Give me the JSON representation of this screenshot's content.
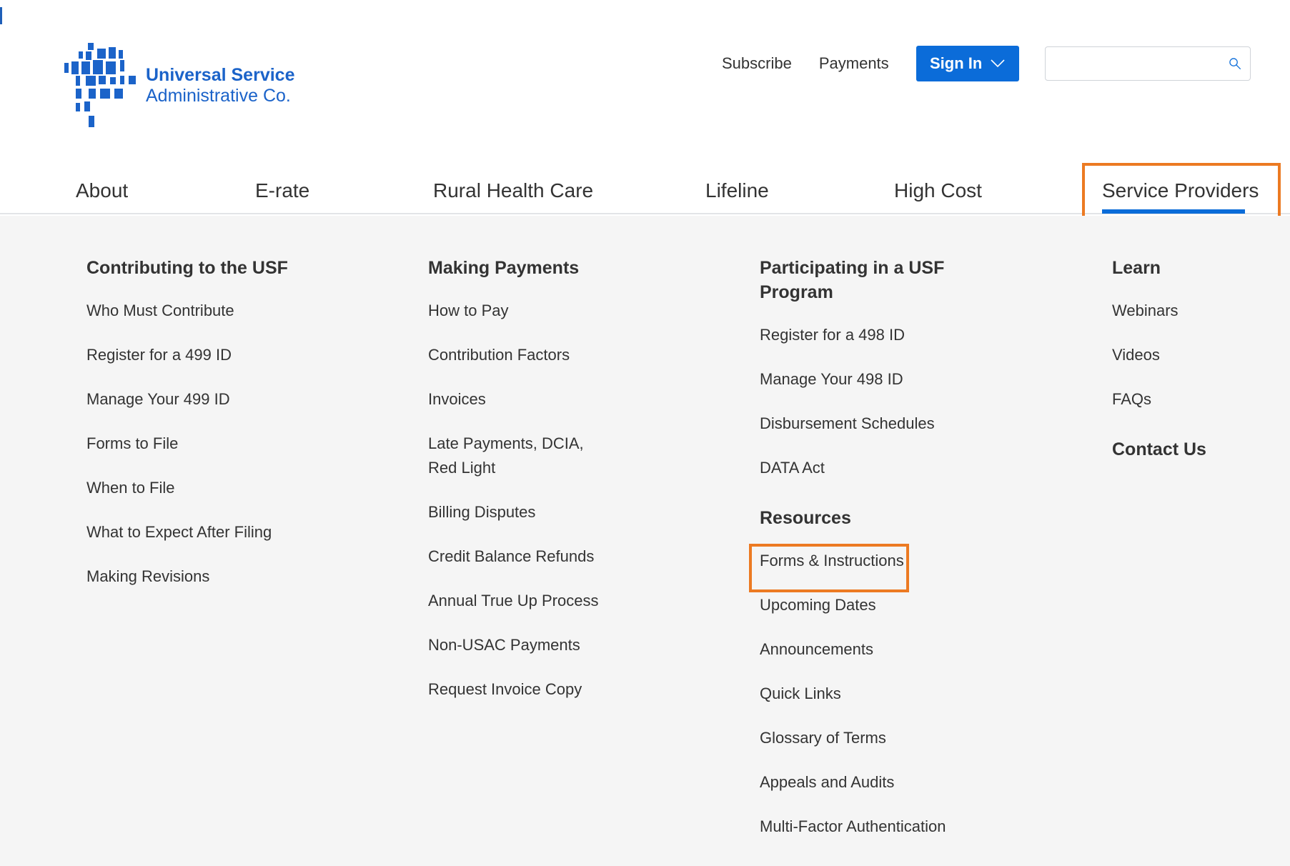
{
  "header": {
    "logo": {
      "line1": "Universal Service",
      "line2": "Administrative Co.",
      "icon": "usac-logo-icon"
    },
    "utility": {
      "subscribe_label": "Subscribe",
      "payments_label": "Payments",
      "signin_label": "Sign In",
      "signin_icon": "chevron-down-icon",
      "search_placeholder": "",
      "search_icon": "search-icon"
    }
  },
  "nav": {
    "items": [
      {
        "label": "About"
      },
      {
        "label": "E-rate"
      },
      {
        "label": "Rural Health Care"
      },
      {
        "label": "Lifeline"
      },
      {
        "label": "High Cost"
      },
      {
        "label": "Service Providers"
      }
    ],
    "active": "Service Providers"
  },
  "mega": {
    "contributing": {
      "title": "Contributing to the USF",
      "links": [
        "Who Must Contribute",
        "Register for a 499 ID",
        "Manage Your 499 ID",
        "Forms to File",
        "When to File",
        "What to Expect After Filing",
        "Making Revisions"
      ]
    },
    "payments": {
      "title": "Making Payments",
      "links": [
        "How to Pay",
        "Contribution Factors",
        "Invoices",
        "Late Payments, DCIA, Red Light",
        "Billing Disputes",
        "Credit Balance Refunds",
        "Annual True Up Process",
        "Non-USAC Payments",
        "Request Invoice Copy"
      ]
    },
    "participating": {
      "title": "Participating in a USF Program",
      "links": [
        "Register for a 498 ID",
        "Manage Your 498 ID",
        "Disbursement Schedules",
        "DATA Act"
      ]
    },
    "resources": {
      "title": "Resources",
      "links": [
        "Forms & Instructions",
        "Upcoming Dates",
        "Announcements",
        "Quick Links",
        "Glossary of Terms",
        "Appeals and Audits",
        "Multi-Factor Authentication"
      ]
    },
    "learn": {
      "title": "Learn",
      "links": [
        "Webinars",
        "Videos",
        "FAQs"
      ]
    },
    "contact": {
      "title": "Contact Us"
    }
  },
  "colors": {
    "brand_blue": "#0b6cd9",
    "highlight_orange": "#ec7a22",
    "menu_bg": "#f5f5f5"
  }
}
